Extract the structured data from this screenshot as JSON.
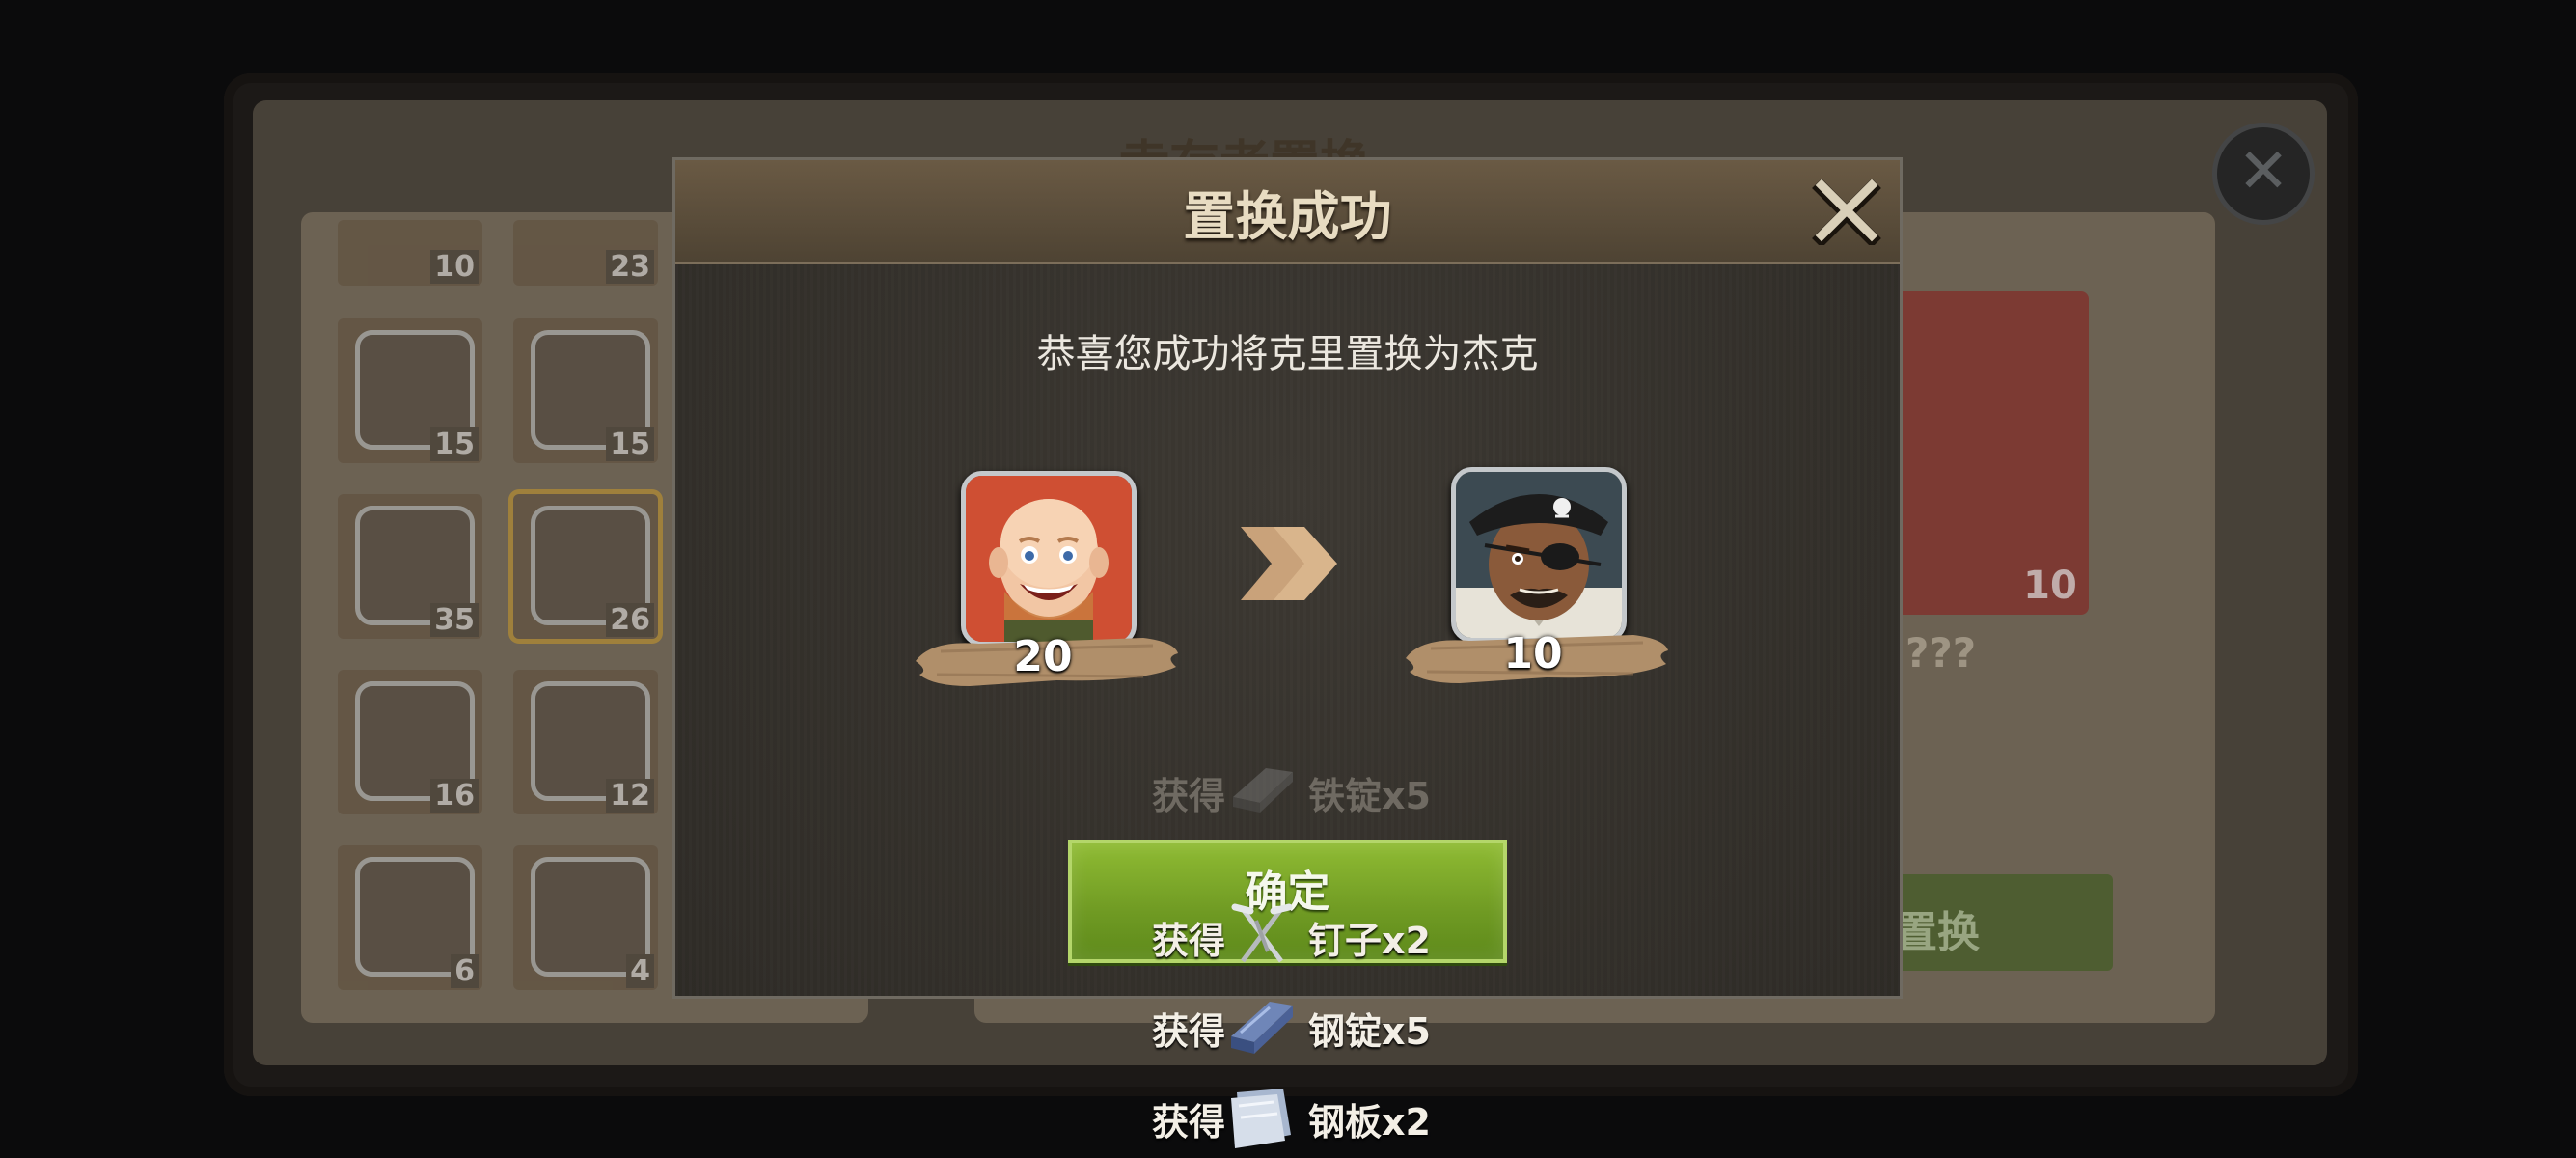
{
  "background": {
    "panel_title": "幸存者置换",
    "grid_levels": [
      "10",
      "23",
      "15",
      "15",
      "35",
      "26",
      "16",
      "12",
      "6",
      "4"
    ],
    "target_level": "10",
    "target_name": "???",
    "swap_button_label": "置换"
  },
  "dialog": {
    "title": "置换成功",
    "message": "恭喜您成功将克里置换为杰克",
    "from_hero": {
      "level": "20",
      "icon": "kerry-portrait-icon"
    },
    "to_hero": {
      "level": "10",
      "icon": "jack-pirate-portrait-icon"
    },
    "confirm_label": "确定"
  },
  "rewards": [
    {
      "prefix": "获得",
      "item": "铁锭x5",
      "icon": "iron-ingot-icon"
    },
    {
      "prefix": "获得",
      "item": "钉子x2",
      "icon": "nails-icon"
    },
    {
      "prefix": "获得",
      "item": "钢锭x5",
      "icon": "steel-ingot-icon"
    },
    {
      "prefix": "获得",
      "item": "钢板x2",
      "icon": "steel-plate-icon"
    }
  ],
  "colors": {
    "title_text": "#e8dcc2",
    "confirm_green": "#7aa62a",
    "level_brush": "#b08f6a"
  }
}
